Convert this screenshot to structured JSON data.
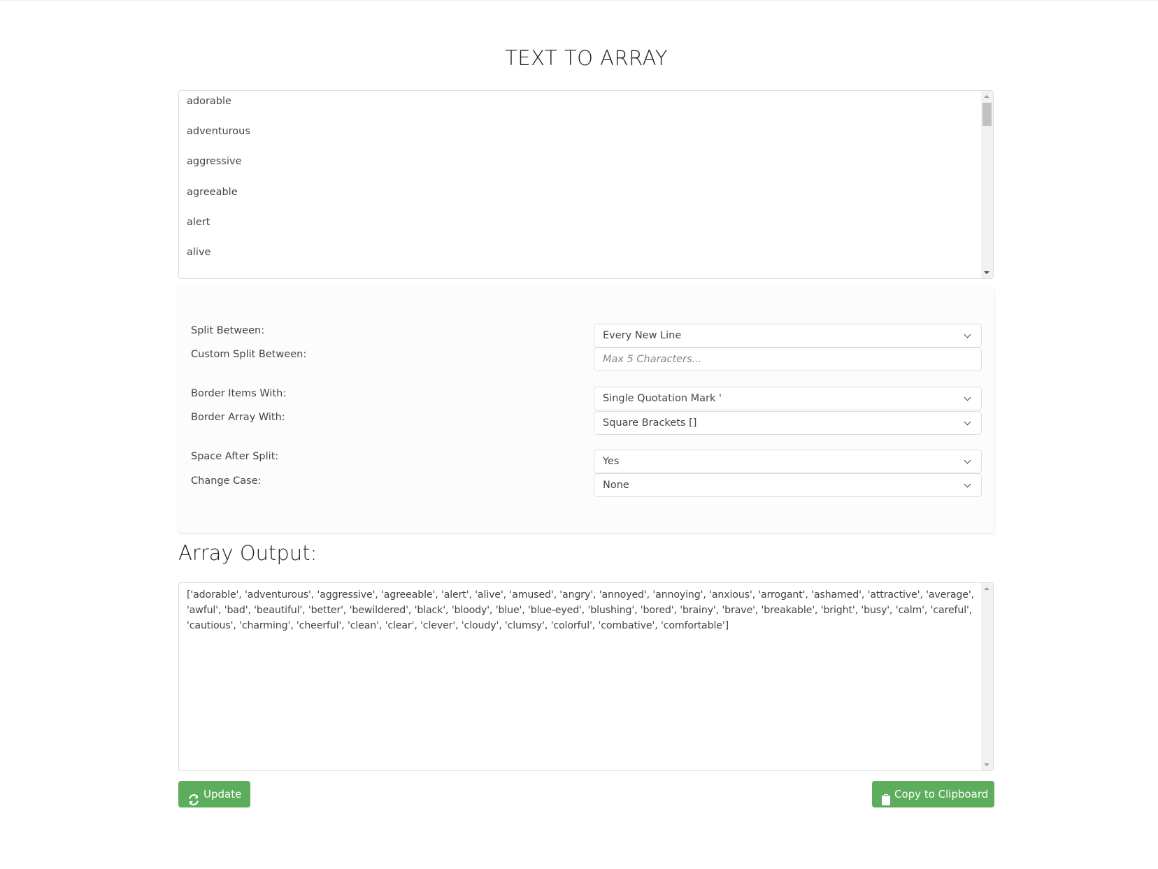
{
  "page": {
    "title": "TEXT TO ARRAY"
  },
  "input": {
    "lines": [
      "adorable",
      "adventurous",
      "aggressive",
      "agreeable",
      "alert",
      "alive"
    ],
    "scroll_position": 0.02
  },
  "options": {
    "split_between": {
      "label": "Split Between:",
      "value": "Every New Line"
    },
    "custom_split": {
      "label": "Custom Split Between:",
      "placeholder": "Max 5 Characters...",
      "value": ""
    },
    "border_items": {
      "label": "Border Items With:",
      "value": "Single Quotation Mark '"
    },
    "border_array": {
      "label": "Border Array With:",
      "value": "Square Brackets []"
    },
    "space_after_split": {
      "label": "Space After Split:",
      "value": "Yes"
    },
    "change_case": {
      "label": "Change Case:",
      "value": "None"
    }
  },
  "output": {
    "heading": "Array Output:",
    "lines": [
      "['adorable', 'adventurous', 'aggressive', 'agreeable', 'alert', 'alive', 'amused', 'angry', 'annoyed', 'annoying', 'anxious', 'arrogant', 'ashamed', 'attractive', 'average',",
      "'awful', 'bad', 'beautiful', 'better', 'bewildered', 'black', 'bloody', 'blue', 'blue-eyed', 'blushing', 'bored', 'brainy', 'brave', 'breakable', 'bright', 'busy', 'calm', 'careful',",
      "'cautious', 'charming', 'cheerful', 'clean', 'clear', 'clever', 'cloudy', 'clumsy', 'colorful', 'combative', 'comfortable']"
    ]
  },
  "buttons": {
    "update": {
      "label": "Update",
      "icon": "refresh-icon"
    },
    "copy": {
      "label": "Copy to Clipboard",
      "icon": "clipboard-icon"
    }
  },
  "colors": {
    "button_green": "#5cad5c"
  }
}
